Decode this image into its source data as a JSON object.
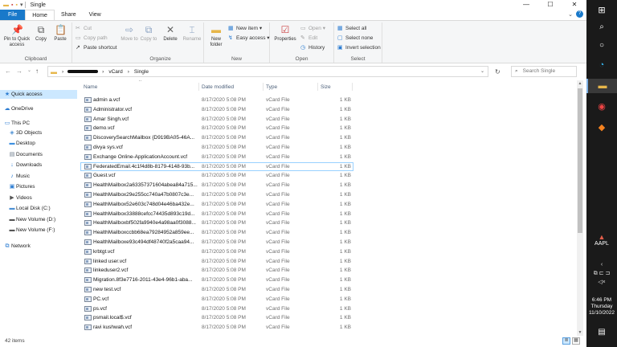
{
  "window": {
    "title": "Single",
    "controls": {
      "minimize": "—",
      "maximize": "☐",
      "close": "✕"
    }
  },
  "ribbon_tabs": [
    "File",
    "Home",
    "Share",
    "View"
  ],
  "ribbon": {
    "clipboard": {
      "label": "Clipboard",
      "pin": "Pin to Quick access",
      "copy": "Copy",
      "paste": "Paste",
      "cut": "Cut",
      "copy_path": "Copy path",
      "paste_shortcut": "Paste shortcut"
    },
    "organize": {
      "label": "Organize",
      "move_to": "Move to",
      "copy_to": "Copy to",
      "delete": "Delete",
      "rename": "Rename"
    },
    "new": {
      "label": "New",
      "new_folder": "New folder",
      "new_item": "New item",
      "easy_access": "Easy access"
    },
    "open": {
      "label": "Open",
      "properties": "Properties",
      "open": "Open",
      "edit": "Edit",
      "history": "History"
    },
    "select": {
      "label": "Select",
      "select_all": "Select all",
      "select_none": "Select none",
      "invert": "Invert selection"
    }
  },
  "address": {
    "crumbs": [
      "vCard",
      "Single"
    ],
    "search_placeholder": "Search Single"
  },
  "nav": [
    {
      "label": "Quick access",
      "icon": "★",
      "color": "#2d7dd2",
      "selected": true
    },
    {
      "label": "OneDrive",
      "icon": "☁",
      "color": "#2d7dd2"
    },
    {
      "label": "This PC",
      "icon": "▭",
      "color": "#2d7dd2"
    },
    {
      "label": "3D Objects",
      "icon": "◈",
      "color": "#4a8fd4"
    },
    {
      "label": "Desktop",
      "icon": "▬",
      "color": "#3c8fe0"
    },
    {
      "label": "Documents",
      "icon": "▤",
      "color": "#6d7a8a"
    },
    {
      "label": "Downloads",
      "icon": "↓",
      "color": "#2d7dd2"
    },
    {
      "label": "Music",
      "icon": "♪",
      "color": "#2d7dd2"
    },
    {
      "label": "Pictures",
      "icon": "▣",
      "color": "#2d7dd2"
    },
    {
      "label": "Videos",
      "icon": "▶",
      "color": "#555"
    },
    {
      "label": "Local Disk (C:)",
      "icon": "▬",
      "color": "#4a8fd4"
    },
    {
      "label": "New Volume (D:)",
      "icon": "▬",
      "color": "#555"
    },
    {
      "label": "New Volume (F:)",
      "icon": "▬",
      "color": "#555"
    },
    {
      "label": "Network",
      "icon": "⧉",
      "color": "#2d7dd2"
    }
  ],
  "columns": {
    "name": "Name",
    "date": "Date modified",
    "type": "Type",
    "size": "Size"
  },
  "files": [
    {
      "name": "admin a.vcf",
      "date": "8/17/2020 5:08 PM",
      "type": "vCard File",
      "size": "1 KB"
    },
    {
      "name": "Administrator.vcf",
      "date": "8/17/2020 5:08 PM",
      "type": "vCard File",
      "size": "1 KB"
    },
    {
      "name": "Amar Singh.vcf",
      "date": "8/17/2020 5:08 PM",
      "type": "vCard File",
      "size": "1 KB"
    },
    {
      "name": "demo.vcf",
      "date": "8/17/2020 5:08 PM",
      "type": "vCard File",
      "size": "1 KB"
    },
    {
      "name": "DiscoverySearchMailbox {D919BA05-46A...",
      "date": "8/17/2020 5:08 PM",
      "type": "vCard File",
      "size": "1 KB"
    },
    {
      "name": "divya sys.vcf",
      "date": "8/17/2020 5:08 PM",
      "type": "vCard File",
      "size": "1 KB"
    },
    {
      "name": "Exchange Online-ApplicationAccount.vcf",
      "date": "8/17/2020 5:08 PM",
      "type": "vCard File",
      "size": "1 KB"
    },
    {
      "name": "FederatedEmail.4c1f4d8b-8179-4148-93b...",
      "date": "8/17/2020 5:08 PM",
      "type": "vCard File",
      "size": "1 KB",
      "focused": true
    },
    {
      "name": "Guest.vcf",
      "date": "8/17/2020 5:08 PM",
      "type": "vCard File",
      "size": "1 KB"
    },
    {
      "name": "HealthMailbox2a63357371604abea84a715...",
      "date": "8/17/2020 5:08 PM",
      "type": "vCard File",
      "size": "1 KB"
    },
    {
      "name": "HealthMailbox29e255cc740a47b0807c3e...",
      "date": "8/17/2020 5:08 PM",
      "type": "vCard File",
      "size": "1 KB"
    },
    {
      "name": "HealthMailbox52e603c748d04e46ba432e...",
      "date": "8/17/2020 5:08 PM",
      "type": "vCard File",
      "size": "1 KB"
    },
    {
      "name": "HealthMailbox33888cefcc74435d893c19d...",
      "date": "8/17/2020 5:08 PM",
      "type": "vCard File",
      "size": "1 KB"
    },
    {
      "name": "HealthMailboxbf502fa9940e4a98aa0f3088...",
      "date": "8/17/2020 5:08 PM",
      "type": "vCard File",
      "size": "1 KB"
    },
    {
      "name": "HealthMailboxccbb68ea79284952a859ee...",
      "date": "8/17/2020 5:08 PM",
      "type": "vCard File",
      "size": "1 KB"
    },
    {
      "name": "HealthMailboxe93c494df48740f2a5caa94...",
      "date": "8/17/2020 5:08 PM",
      "type": "vCard File",
      "size": "1 KB"
    },
    {
      "name": "krbtgt.vcf",
      "date": "8/17/2020 5:08 PM",
      "type": "vCard File",
      "size": "1 KB"
    },
    {
      "name": "linked user.vcf",
      "date": "8/17/2020 5:08 PM",
      "type": "vCard File",
      "size": "1 KB"
    },
    {
      "name": "linkeduser2.vcf",
      "date": "8/17/2020 5:08 PM",
      "type": "vCard File",
      "size": "1 KB"
    },
    {
      "name": "Migration.8f3e7716-2011-43e4-96b1-aba...",
      "date": "8/17/2020 5:08 PM",
      "type": "vCard File",
      "size": "1 KB"
    },
    {
      "name": "new test.vcf",
      "date": "8/17/2020 5:08 PM",
      "type": "vCard File",
      "size": "1 KB"
    },
    {
      "name": "PC.vcf",
      "date": "8/17/2020 5:08 PM",
      "type": "vCard File",
      "size": "1 KB"
    },
    {
      "name": "ps.vcf",
      "date": "8/17/2020 5:08 PM",
      "type": "vCard File",
      "size": "1 KB"
    },
    {
      "name": "psmail.local$.vcf",
      "date": "8/17/2020 5:08 PM",
      "type": "vCard File",
      "size": "1 KB"
    },
    {
      "name": "ravi kushwah.vcf",
      "date": "8/17/2020 5:08 PM",
      "type": "vCard File",
      "size": "1 KB"
    }
  ],
  "status": {
    "items": "42 items"
  },
  "taskbar": {
    "stock": "AAPL",
    "time": "6:46 PM",
    "day": "Thursday",
    "date": "11/10/2022"
  }
}
